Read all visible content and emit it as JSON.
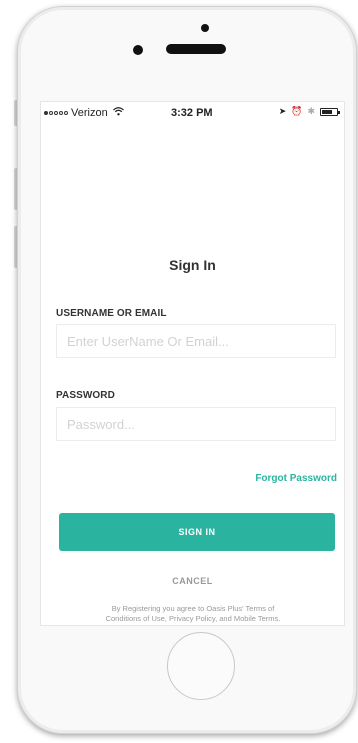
{
  "status_bar": {
    "carrier": "Verizon",
    "wifi_icon": "wifi-icon",
    "time": "3:32 PM",
    "location_icon": "➤",
    "alarm_icon": "⏰",
    "bluetooth_icon": "✱"
  },
  "login": {
    "title": "Sign In",
    "username_label": "USERNAME OR EMAIL",
    "username_placeholder": "Enter UserName Or Email...",
    "username_value": "",
    "password_label": "PASSWORD",
    "password_placeholder": "Password...",
    "password_value": "",
    "forgot_label": "Forgot Password",
    "signin_label": "SIGN IN",
    "cancel_label": "CANCEL",
    "terms_line1": "By Registering you agree to Oasis Plus' Terms of",
    "terms_line2": "Conditions of Use, Privacy Policy, and Mobile Terms."
  },
  "colors": {
    "accent": "#2ab4a0",
    "forgot_link": "#2bb5a0",
    "cancel_text": "#999999"
  }
}
